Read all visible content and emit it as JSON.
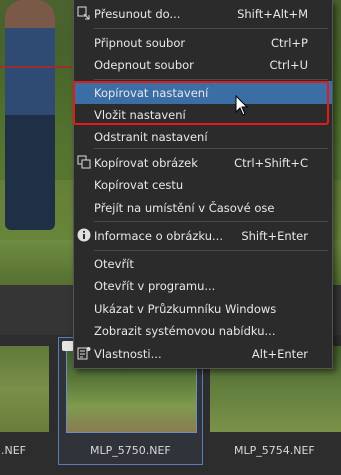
{
  "menu": {
    "items": [
      {
        "label": "Přesunout do...",
        "shortcut": "Shift+Alt+M",
        "icon": "move-icon"
      },
      {
        "label": "Připnout soubor",
        "shortcut": "Ctrl+P"
      },
      {
        "label": "Odepnout soubor",
        "shortcut": "Ctrl+U"
      },
      {
        "label": "Kopírovat nastavení",
        "shortcut": ""
      },
      {
        "label": "Vložit nastavení",
        "shortcut": ""
      },
      {
        "label": "Odstranit nastavení",
        "shortcut": ""
      },
      {
        "label": "Kopírovat obrázek",
        "shortcut": "Ctrl+Shift+C",
        "icon": "copy-image-icon"
      },
      {
        "label": "Kopírovat cestu",
        "shortcut": ""
      },
      {
        "label": "Přejít na umístění v Časové ose",
        "shortcut": ""
      },
      {
        "label": "Informace o obrázku...",
        "shortcut": "Shift+Enter",
        "icon": "info-icon"
      },
      {
        "label": "Otevřít",
        "shortcut": ""
      },
      {
        "label": "Otevřít v programu...",
        "shortcut": ""
      },
      {
        "label": "Ukázat v Průzkumníku Windows",
        "shortcut": ""
      },
      {
        "label": "Zobrazit systémovou nabídku...",
        "shortcut": ""
      },
      {
        "label": "Vlastnosti...",
        "shortcut": "Alt+Enter",
        "icon": "properties-icon"
      }
    ]
  },
  "filmstrip": {
    "thumbs": [
      {
        "label": ".NEF"
      },
      {
        "label": "MLP_5750.NEF"
      },
      {
        "label": "MLP_5754.NEF"
      }
    ]
  },
  "colors": {
    "highlight": "#3a6ea5",
    "callout": "#e01b1b",
    "menu_bg": "#2b2b2b"
  }
}
